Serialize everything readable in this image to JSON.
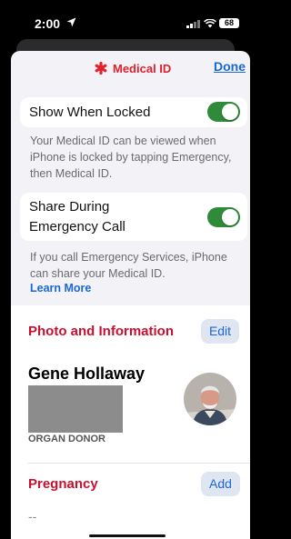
{
  "status_bar": {
    "time": "2:00",
    "battery": "68",
    "icons": [
      "location-arrow-icon",
      "signal-icon",
      "wifi-icon",
      "battery-icon"
    ]
  },
  "nav": {
    "title": "Medical ID",
    "title_icon": "asterisk-icon",
    "done_label": "Done"
  },
  "settings": {
    "show_when_locked": {
      "label": "Show When Locked",
      "on": true
    },
    "locked_note": "Your Medical ID can be viewed when iPhone is locked by tapping Emergency, then Medical ID.",
    "share_during_call": {
      "label_line1": "Share During",
      "label_line2": "Emergency Call",
      "on": true
    },
    "share_note": "If you call Emergency Services, iPhone can share your Medical ID.",
    "learn_more": "Learn More"
  },
  "photo_info": {
    "title": "Photo and Information",
    "edit_label": "Edit",
    "name": "Gene Hollaway",
    "organ_donor": "ORGAN DONOR"
  },
  "pregnancy": {
    "title": "Pregnancy",
    "add_label": "Add",
    "value": "--"
  },
  "colors": {
    "accent_red": "#c8102e",
    "link_blue": "#1b67d8",
    "toggle_green": "#2f8a3a"
  }
}
